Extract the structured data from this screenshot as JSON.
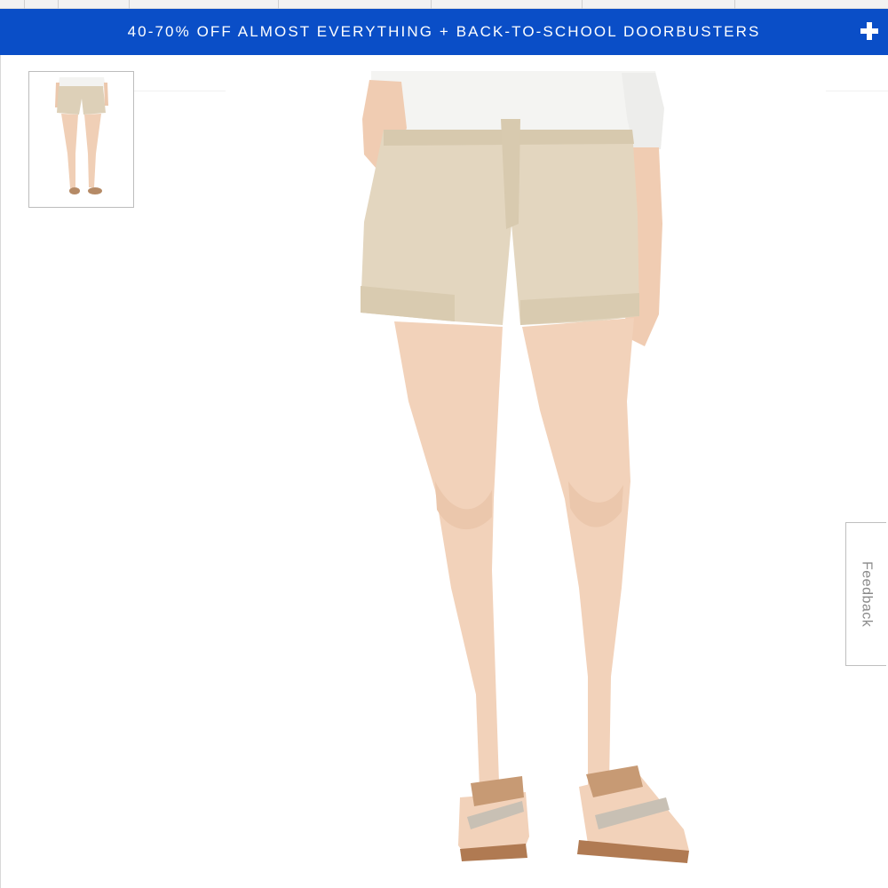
{
  "promo_banner": {
    "text": "40-70% OFF ALMOST EVERYTHING + BACK-TO-SCHOOL DOORBUSTERS",
    "expand_icon": "plus-icon",
    "background_color": "#0a4ec7",
    "text_color": "#ffffff"
  },
  "product_gallery": {
    "thumbnails": [
      {
        "icon": "product-thumbnail-image",
        "selected": true
      }
    ],
    "main_image": "product-main-image",
    "product_color": "#e3d6bf"
  },
  "feedback_tab": {
    "label": "Feedback"
  }
}
